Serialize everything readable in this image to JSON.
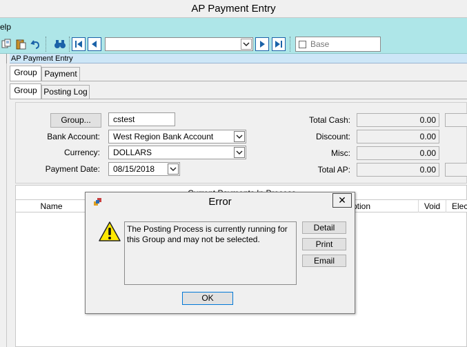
{
  "window": {
    "title": "AP Payment Entry"
  },
  "menu": {
    "help_label": "elp"
  },
  "toolbar": {
    "base_label": "Base",
    "icons": [
      "copy-icon",
      "paste-icon",
      "undo-icon",
      "binoculars-icon",
      "first-record-icon",
      "previous-record-icon",
      "next-record-icon",
      "last-record-icon"
    ]
  },
  "child": {
    "caption": "AP Payment Entry"
  },
  "tabs": {
    "outer": [
      {
        "label": "Group"
      },
      {
        "label": "Payment"
      }
    ],
    "inner": [
      {
        "label": "Group"
      },
      {
        "label": "Posting Log"
      }
    ]
  },
  "form": {
    "group_button": "Group...",
    "group_value": "cstest",
    "bank_account_label": "Bank Account:",
    "bank_account_value": "West Region Bank Account",
    "currency_label": "Currency:",
    "currency_value": "DOLLARS",
    "payment_date_label": "Payment Date:",
    "payment_date_value": "08/15/2018"
  },
  "totals": {
    "total_cash_label": "Total Cash:",
    "total_cash_value": "0.00",
    "discount_label": "Discount:",
    "discount_value": "0.00",
    "misc_label": "Misc:",
    "misc_value": "0.00",
    "total_ap_label": "Total AP:",
    "total_ap_value": "0.00"
  },
  "grid": {
    "title": "Current Payments In Process",
    "columns": [
      "Name",
      "ption",
      "Void",
      "Elec"
    ]
  },
  "dialog": {
    "title": "Error",
    "close_glyph": "✕",
    "message": "The Posting Process is currently running for this Group and may not be selected.",
    "buttons": {
      "detail": "Detail",
      "print": "Print",
      "email": "Email",
      "ok": "OK"
    }
  },
  "colors": {
    "toolbar_bg": "#aee6e8",
    "accent_blue": "#1a62a8",
    "warning_yellow": "#ffe800"
  }
}
